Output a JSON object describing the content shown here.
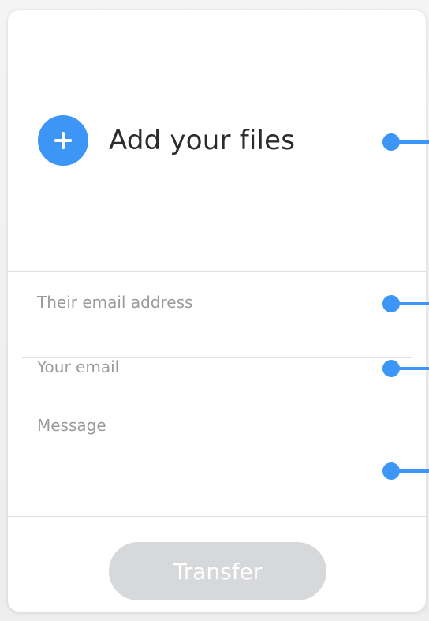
{
  "upload": {
    "add_label": "Add your files",
    "icon": "plus-icon"
  },
  "form": {
    "recipient_placeholder": "Their email address",
    "sender_placeholder": "Your email",
    "message_placeholder": "Message"
  },
  "actions": {
    "transfer_label": "Transfer"
  },
  "colors": {
    "accent": "#3d95f5",
    "disabled_button": "#d7d8da"
  }
}
